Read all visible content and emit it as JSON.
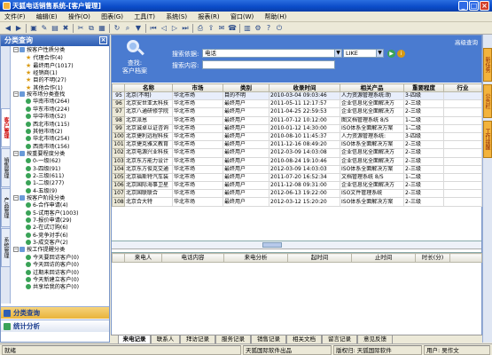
{
  "window": {
    "title": "天狐电话销售系统-[客户管理]"
  },
  "menu": [
    "文件(F)",
    "编辑(E)",
    "操作(O)",
    "图表(G)",
    "工具(T)",
    "系统(S)",
    "报表(R)",
    "窗口(W)",
    "帮助(H)"
  ],
  "left": {
    "title": "分类查询",
    "vtabs": [
      "客户管理",
      "销售管理",
      "产品管理",
      "系统管理"
    ],
    "tree": [
      {
        "label": "按客户性质分类",
        "level": 0,
        "type": "group"
      },
      {
        "label": "代理合作(4)",
        "level": 1,
        "type": "star"
      },
      {
        "label": "最终用户(1017)",
        "level": 1,
        "type": "star"
      },
      {
        "label": "经销商(1)",
        "level": 1,
        "type": "star"
      },
      {
        "label": "目的不明(27)",
        "level": 1,
        "type": "star"
      },
      {
        "label": "其他合作(1)",
        "level": 1,
        "type": "star"
      },
      {
        "label": "按市场分类查找",
        "level": 0,
        "type": "group"
      },
      {
        "label": "华南市场(264)",
        "level": 1,
        "type": "item"
      },
      {
        "label": "华东市场(224)",
        "level": 1,
        "type": "item"
      },
      {
        "label": "华中市场(52)",
        "level": 1,
        "type": "item"
      },
      {
        "label": "西北市场(115)",
        "level": 1,
        "type": "item"
      },
      {
        "label": "其他市场(2)",
        "level": 1,
        "type": "item"
      },
      {
        "label": "华北市场(254)",
        "level": 1,
        "type": "item"
      },
      {
        "label": "西南市场(156)",
        "level": 1,
        "type": "item"
      },
      {
        "label": "按重要程度分类",
        "level": 0,
        "type": "group"
      },
      {
        "label": "0-一级(62)",
        "level": 1,
        "type": "item"
      },
      {
        "label": "3-四级(91)",
        "level": 1,
        "type": "item"
      },
      {
        "label": "2-三级(611)",
        "level": 1,
        "type": "item"
      },
      {
        "label": "1-二级(277)",
        "level": 1,
        "type": "item"
      },
      {
        "label": "4-五级(9)",
        "level": 1,
        "type": "item"
      },
      {
        "label": "按客户阶段分类",
        "level": 0,
        "type": "group"
      },
      {
        "label": "6-合作申请(4)",
        "level": 1,
        "type": "item"
      },
      {
        "label": "5-试用客户(1003)",
        "level": 1,
        "type": "item"
      },
      {
        "label": "7-报价申请(29)",
        "level": 1,
        "type": "item"
      },
      {
        "label": "2-在试订购(6)",
        "level": 1,
        "type": "item"
      },
      {
        "label": "6-竞争对手(6)",
        "level": 1,
        "type": "item"
      },
      {
        "label": "3-成交客户(2)",
        "level": 1,
        "type": "item"
      },
      {
        "label": "按工作提醒分类",
        "level": 0,
        "type": "group"
      },
      {
        "label": "今天要回访客户(0)",
        "level": 1,
        "type": "item"
      },
      {
        "label": "今天回访的客户(0)",
        "level": 1,
        "type": "item"
      },
      {
        "label": "过期未回访客户(0)",
        "level": 1,
        "type": "item"
      },
      {
        "label": "今天新建立客户(0)",
        "level": 1,
        "type": "item"
      },
      {
        "label": "共享给我的客户(0)",
        "level": 1,
        "type": "item"
      }
    ],
    "footer": [
      "分类查询",
      "统计分析"
    ]
  },
  "search": {
    "icon_caption1": "查找:",
    "icon_caption2": "客户档案",
    "label1": "搜索依据:",
    "field_value": "电话",
    "operator": "LIKE",
    "label2": "搜索内容:",
    "content_value": "",
    "advanced": "高级查询"
  },
  "grid": {
    "columns": [
      "",
      "名称",
      "市场",
      "类别",
      "收录时间",
      "相关产品",
      "重要程度",
      "行业"
    ],
    "rows": [
      [
        "95",
        "北京(不明)",
        "华北市场",
        "目的不明",
        "2010-03-04 09:03:46",
        "人力资源管理系统:助",
        "3-四级",
        ""
      ],
      [
        "96",
        "北京安世亚太科技",
        "华北市场",
        "最终用户",
        "2011-05-11 12:17:57",
        "企业信息化全面解决方",
        "2-三级",
        ""
      ],
      [
        "97",
        "北京八通研修学院",
        "华北市场",
        "最终用户",
        "2011-04-25 22:59:53",
        "企业信息化全面解决方",
        "2-三级",
        ""
      ],
      [
        "98",
        "北京派恩",
        "华北市场",
        "最终用户",
        "2011-07-12 10:12:00",
        "图文档管理系统 8/S",
        "1-二级",
        ""
      ],
      [
        "99",
        "北京诚卓以证咨询",
        "华北市场",
        "最终用户",
        "2010-01-12 14:30:00",
        "ISO体系全面解决方案",
        "1-二级",
        ""
      ],
      [
        "100",
        "北京捷利远程科技",
        "华北市场",
        "最终用户",
        "2010-08-10 11:45:37",
        "人力资源管理系统:",
        "3-四级",
        ""
      ],
      [
        "101",
        "北京捷克雅文教育",
        "华北市场",
        "最终用户",
        "2011-12-16 08:49:20",
        "ISO体系全面解决方案",
        "2-三级",
        ""
      ],
      [
        "102",
        "北京电源兴业科技",
        "华北市场",
        "最终用户",
        "2012-03-09 14:03:08",
        "企业信息化全面解决方",
        "2-三级",
        ""
      ],
      [
        "103",
        "北京东方能力设计",
        "华北市场",
        "最终用户",
        "2010-08-24 19:10:46",
        "企业信息化全面解决方",
        "2-三级",
        ""
      ],
      [
        "104",
        "北京东方俊克交通",
        "华北市场",
        "最终用户",
        "2012-03-09 14:03:03",
        "ISO体系全面解决方案",
        "2-三级",
        ""
      ],
      [
        "105",
        "北京福斯特汽车装",
        "华北市场",
        "最终用户",
        "2011-07-20 16:52:34",
        "文档管理系统 8/S",
        "1-二级",
        ""
      ],
      [
        "106",
        "北京国际海事卫星",
        "华北市场",
        "最终用户",
        "2011-12-08 09:31:00",
        "企业信息化全面解决方",
        "2-三级",
        ""
      ],
      [
        "107",
        "北京国联联合",
        "华北市场",
        "最终用户",
        "2012-06-13 19:22:00",
        "ISO文件管理系统",
        "2-三级",
        ""
      ],
      [
        "108",
        "北京合大特",
        "华北市场",
        "最终用户",
        "2012-03-12 15:20:20",
        "ISO体系全面解决方案",
        "2-三级",
        ""
      ]
    ],
    "selected_row": 0
  },
  "callgrid": {
    "columns": [
      "来电人",
      "电话内容",
      "来电分析",
      "起时间",
      "止时间",
      "时长(分)"
    ]
  },
  "right_tabs": [
    "新任务",
    "公告栏",
    "工作提醒"
  ],
  "bottom_tabs": [
    "来电记录",
    "联系人",
    "拜访记录",
    "服务记录",
    "销售记录",
    "相关文档",
    "留言记录",
    "意见反馈"
  ],
  "status": {
    "left": "就绪",
    "company": "天狐国际软件出品",
    "copyright": "版权归: 天狐国际软件",
    "user": "用户: 吴作文"
  },
  "colors": {
    "accent": "#4a7bd0",
    "title": "#0a4bc8",
    "highlight": "#f3b33c"
  }
}
